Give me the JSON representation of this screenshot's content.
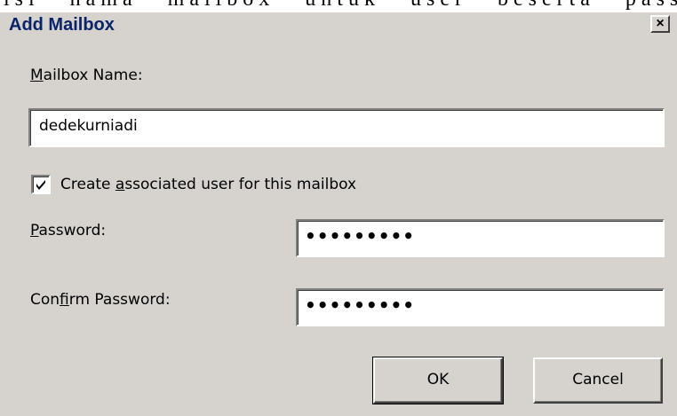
{
  "background_text": "isi nama mailbox untuk user beserta passwordnya n",
  "dialog": {
    "title": "Add Mailbox",
    "close_label": "×"
  },
  "mailbox": {
    "label_accel": "M",
    "label_rest": "ailbox Name:",
    "value": "dedekurniadi"
  },
  "associate_user": {
    "checked": true,
    "label_pre": "Create ",
    "label_accel": "a",
    "label_post": "ssociated user for this mailbox"
  },
  "password": {
    "label_accel": "P",
    "label_rest": "assword:",
    "masked_value": "•••••••••"
  },
  "confirm_password": {
    "label_pre": "Con",
    "label_accel": "f",
    "label_post": "irm Password:",
    "masked_value": "•••••••••"
  },
  "buttons": {
    "ok": "OK",
    "cancel": "Cancel"
  },
  "colors": {
    "dialog_face": "#d6d3ce",
    "title_text": "#0a246a"
  }
}
